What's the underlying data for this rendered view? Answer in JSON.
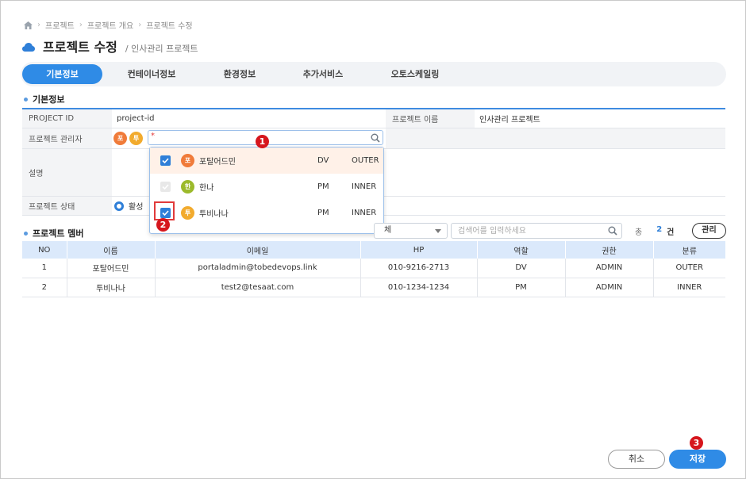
{
  "breadcrumb": {
    "items": [
      "프로젝트",
      "프로젝트 개요",
      "프로젝트 수정"
    ]
  },
  "header": {
    "title": "프로젝트 수정",
    "subtitle": "/ 인사관리 프로젝트"
  },
  "tabs": [
    {
      "label": "기본정보",
      "active": true
    },
    {
      "label": "컨테이너정보",
      "active": false
    },
    {
      "label": "환경정보",
      "active": false
    },
    {
      "label": "추가서비스",
      "active": false
    },
    {
      "label": "오토스케일링",
      "active": false
    }
  ],
  "basic_info": {
    "section_title": "기본정보",
    "project_id_label": "PROJECT ID",
    "project_id_value": "project-id",
    "project_name_label": "프로젝트 이름",
    "project_name_value": "인사관리 프로젝트",
    "manager_label": "프로젝트 관리자",
    "manager_avatars": [
      "포",
      "투"
    ],
    "manager_input_value": "",
    "required_mark": "*",
    "description_label": "설명",
    "status_label": "프로젝트 상태",
    "status_value": "활성"
  },
  "manager_dropdown": {
    "items": [
      {
        "avatar": "포",
        "name": "포탈어드민",
        "role": "DV",
        "type": "OUTER",
        "checked": true,
        "disabled": false,
        "highlighted": true
      },
      {
        "avatar": "한",
        "name": "한나",
        "role": "PM",
        "type": "INNER",
        "checked": true,
        "disabled": true,
        "highlighted": false
      },
      {
        "avatar": "투",
        "name": "투비나나",
        "role": "PM",
        "type": "INNER",
        "checked": true,
        "disabled": false,
        "highlighted": false
      }
    ]
  },
  "callouts": [
    "1",
    "2",
    "3"
  ],
  "members": {
    "section_title": "프로젝트 멤버",
    "filter_value": "체",
    "search_placeholder": "검색어를 입력하세요",
    "total_prefix": "총",
    "total_count": "2",
    "total_unit": "건",
    "manage_button": "관리",
    "columns": [
      "NO",
      "이름",
      "이메일",
      "HP",
      "역할",
      "권한",
      "분류"
    ],
    "rows": [
      [
        "1",
        "포탈어드민",
        "portaladmin@tobedevops.link",
        "010-9216-2713",
        "DV",
        "ADMIN",
        "OUTER"
      ],
      [
        "2",
        "투비나나",
        "test2@tesaat.com",
        "010-1234-1234",
        "PM",
        "ADMIN",
        "INNER"
      ]
    ]
  },
  "footer": {
    "cancel_label": "취소",
    "save_label": "저장"
  },
  "colors": {
    "accent": "#2f8be6",
    "callout": "#d6161d",
    "table_header": "#dbe9fb"
  }
}
